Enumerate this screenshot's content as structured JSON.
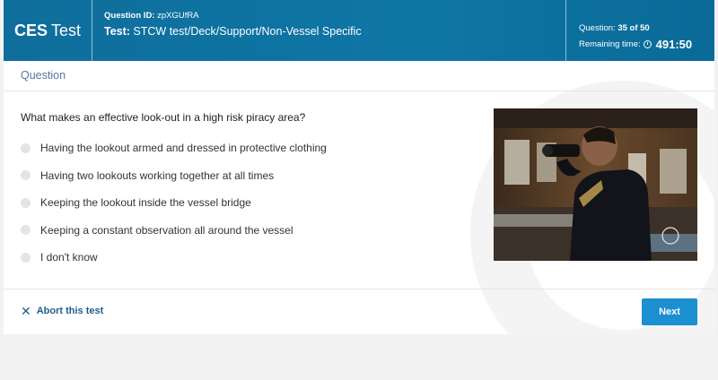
{
  "header": {
    "brand_bold": "CES",
    "brand_rest": "Test",
    "question_id_label": "Question ID:",
    "question_id": "zpXGUfRA",
    "test_label": "Test:",
    "test_path": "STCW test/Deck/Support/Non-Vessel Specific",
    "question_label": "Question:",
    "question_progress": "35 of 50",
    "remaining_label": "Remaining time:",
    "remaining_time": "491:50"
  },
  "section_title": "Question",
  "question_text": "What makes an effective look-out in a high risk piracy area?",
  "options": [
    "Having the lookout armed and dressed in protective clothing",
    "Having two lookouts working together at all times",
    "Keeping the lookout inside the vessel bridge",
    "Keeping a constant observation all around the vessel",
    "I don't know"
  ],
  "footer": {
    "abort_label": "Abort this test",
    "next_label": "Next"
  },
  "colors": {
    "header": "#0e76a5",
    "next_button": "#1b8fd0",
    "link": "#1c5f8f"
  }
}
